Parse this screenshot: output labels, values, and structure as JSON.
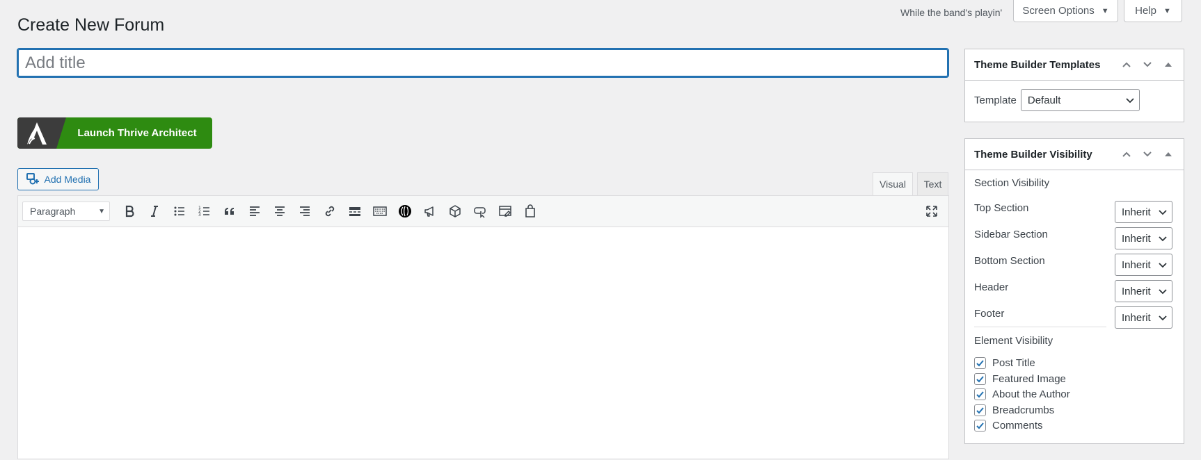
{
  "header": {
    "lyric": "While the band's playin'",
    "screen_options": "Screen Options",
    "help": "Help",
    "page_title": "Create New Forum"
  },
  "title_field": {
    "placeholder": "Add title",
    "value": ""
  },
  "thrive": {
    "label": "Launch Thrive Architect"
  },
  "media": {
    "add_media": "Add Media"
  },
  "editor": {
    "tabs": {
      "visual": "Visual",
      "text": "Text"
    },
    "format_select": "Paragraph",
    "toolbar_icons": [
      "bold-icon",
      "italic-icon",
      "bulleted-list-icon",
      "numbered-list-icon",
      "blockquote-icon",
      "align-left-icon",
      "align-center-icon",
      "align-right-icon",
      "link-icon",
      "read-more-icon",
      "keyboard-icon",
      "thrive-icon",
      "megaphone-icon",
      "cube-icon",
      "button-icon",
      "window-edit-icon",
      "shopping-bag-icon",
      "fullscreen-icon"
    ]
  },
  "sidebar": {
    "templates": {
      "title": "Theme Builder Templates",
      "template_label": "Template",
      "template_value": "Default"
    },
    "visibility": {
      "title": "Theme Builder Visibility",
      "section_heading": "Section Visibility",
      "sections": [
        {
          "label": "Top Section",
          "value": "Inherit"
        },
        {
          "label": "Sidebar Section",
          "value": "Inherit"
        },
        {
          "label": "Bottom Section",
          "value": "Inherit"
        },
        {
          "label": "Header",
          "value": "Inherit"
        },
        {
          "label": "Footer",
          "value": "Inherit"
        }
      ],
      "element_heading": "Element Visibility",
      "elements": [
        {
          "label": "Post Title",
          "checked": true
        },
        {
          "label": "Featured Image",
          "checked": true
        },
        {
          "label": "About the Author",
          "checked": true
        },
        {
          "label": "Breadcrumbs",
          "checked": true
        },
        {
          "label": "Comments",
          "checked": true
        }
      ]
    }
  },
  "colors": {
    "accent": "#2271b1",
    "thrive_green": "#2e8b11",
    "thrive_dark": "#3c3c3c"
  }
}
